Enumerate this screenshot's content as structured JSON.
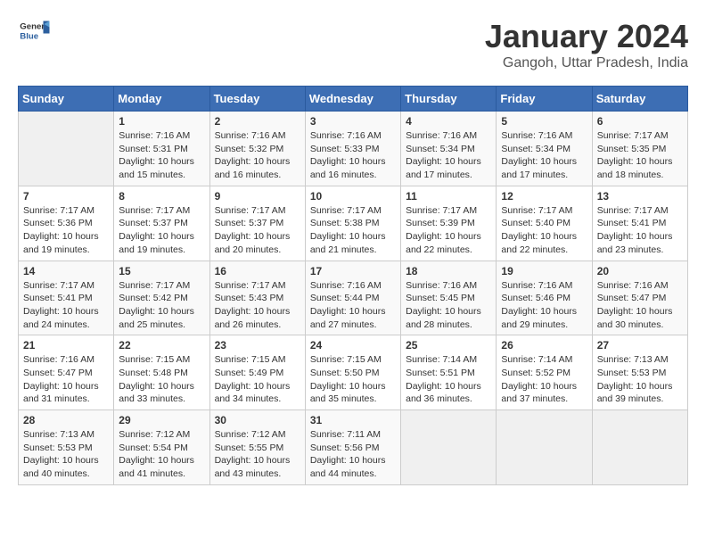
{
  "logo": {
    "text_general": "General",
    "text_blue": "Blue"
  },
  "title": "January 2024",
  "subtitle": "Gangoh, Uttar Pradesh, India",
  "headers": [
    "Sunday",
    "Monday",
    "Tuesday",
    "Wednesday",
    "Thursday",
    "Friday",
    "Saturday"
  ],
  "weeks": [
    [
      {
        "day": "",
        "info": ""
      },
      {
        "day": "1",
        "info": "Sunrise: 7:16 AM\nSunset: 5:31 PM\nDaylight: 10 hours\nand 15 minutes."
      },
      {
        "day": "2",
        "info": "Sunrise: 7:16 AM\nSunset: 5:32 PM\nDaylight: 10 hours\nand 16 minutes."
      },
      {
        "day": "3",
        "info": "Sunrise: 7:16 AM\nSunset: 5:33 PM\nDaylight: 10 hours\nand 16 minutes."
      },
      {
        "day": "4",
        "info": "Sunrise: 7:16 AM\nSunset: 5:34 PM\nDaylight: 10 hours\nand 17 minutes."
      },
      {
        "day": "5",
        "info": "Sunrise: 7:16 AM\nSunset: 5:34 PM\nDaylight: 10 hours\nand 17 minutes."
      },
      {
        "day": "6",
        "info": "Sunrise: 7:17 AM\nSunset: 5:35 PM\nDaylight: 10 hours\nand 18 minutes."
      }
    ],
    [
      {
        "day": "7",
        "info": "Sunrise: 7:17 AM\nSunset: 5:36 PM\nDaylight: 10 hours\nand 19 minutes."
      },
      {
        "day": "8",
        "info": "Sunrise: 7:17 AM\nSunset: 5:37 PM\nDaylight: 10 hours\nand 19 minutes."
      },
      {
        "day": "9",
        "info": "Sunrise: 7:17 AM\nSunset: 5:37 PM\nDaylight: 10 hours\nand 20 minutes."
      },
      {
        "day": "10",
        "info": "Sunrise: 7:17 AM\nSunset: 5:38 PM\nDaylight: 10 hours\nand 21 minutes."
      },
      {
        "day": "11",
        "info": "Sunrise: 7:17 AM\nSunset: 5:39 PM\nDaylight: 10 hours\nand 22 minutes."
      },
      {
        "day": "12",
        "info": "Sunrise: 7:17 AM\nSunset: 5:40 PM\nDaylight: 10 hours\nand 22 minutes."
      },
      {
        "day": "13",
        "info": "Sunrise: 7:17 AM\nSunset: 5:41 PM\nDaylight: 10 hours\nand 23 minutes."
      }
    ],
    [
      {
        "day": "14",
        "info": "Sunrise: 7:17 AM\nSunset: 5:41 PM\nDaylight: 10 hours\nand 24 minutes."
      },
      {
        "day": "15",
        "info": "Sunrise: 7:17 AM\nSunset: 5:42 PM\nDaylight: 10 hours\nand 25 minutes."
      },
      {
        "day": "16",
        "info": "Sunrise: 7:17 AM\nSunset: 5:43 PM\nDaylight: 10 hours\nand 26 minutes."
      },
      {
        "day": "17",
        "info": "Sunrise: 7:16 AM\nSunset: 5:44 PM\nDaylight: 10 hours\nand 27 minutes."
      },
      {
        "day": "18",
        "info": "Sunrise: 7:16 AM\nSunset: 5:45 PM\nDaylight: 10 hours\nand 28 minutes."
      },
      {
        "day": "19",
        "info": "Sunrise: 7:16 AM\nSunset: 5:46 PM\nDaylight: 10 hours\nand 29 minutes."
      },
      {
        "day": "20",
        "info": "Sunrise: 7:16 AM\nSunset: 5:47 PM\nDaylight: 10 hours\nand 30 minutes."
      }
    ],
    [
      {
        "day": "21",
        "info": "Sunrise: 7:16 AM\nSunset: 5:47 PM\nDaylight: 10 hours\nand 31 minutes."
      },
      {
        "day": "22",
        "info": "Sunrise: 7:15 AM\nSunset: 5:48 PM\nDaylight: 10 hours\nand 33 minutes."
      },
      {
        "day": "23",
        "info": "Sunrise: 7:15 AM\nSunset: 5:49 PM\nDaylight: 10 hours\nand 34 minutes."
      },
      {
        "day": "24",
        "info": "Sunrise: 7:15 AM\nSunset: 5:50 PM\nDaylight: 10 hours\nand 35 minutes."
      },
      {
        "day": "25",
        "info": "Sunrise: 7:14 AM\nSunset: 5:51 PM\nDaylight: 10 hours\nand 36 minutes."
      },
      {
        "day": "26",
        "info": "Sunrise: 7:14 AM\nSunset: 5:52 PM\nDaylight: 10 hours\nand 37 minutes."
      },
      {
        "day": "27",
        "info": "Sunrise: 7:13 AM\nSunset: 5:53 PM\nDaylight: 10 hours\nand 39 minutes."
      }
    ],
    [
      {
        "day": "28",
        "info": "Sunrise: 7:13 AM\nSunset: 5:53 PM\nDaylight: 10 hours\nand 40 minutes."
      },
      {
        "day": "29",
        "info": "Sunrise: 7:12 AM\nSunset: 5:54 PM\nDaylight: 10 hours\nand 41 minutes."
      },
      {
        "day": "30",
        "info": "Sunrise: 7:12 AM\nSunset: 5:55 PM\nDaylight: 10 hours\nand 43 minutes."
      },
      {
        "day": "31",
        "info": "Sunrise: 7:11 AM\nSunset: 5:56 PM\nDaylight: 10 hours\nand 44 minutes."
      },
      {
        "day": "",
        "info": ""
      },
      {
        "day": "",
        "info": ""
      },
      {
        "day": "",
        "info": ""
      }
    ]
  ]
}
